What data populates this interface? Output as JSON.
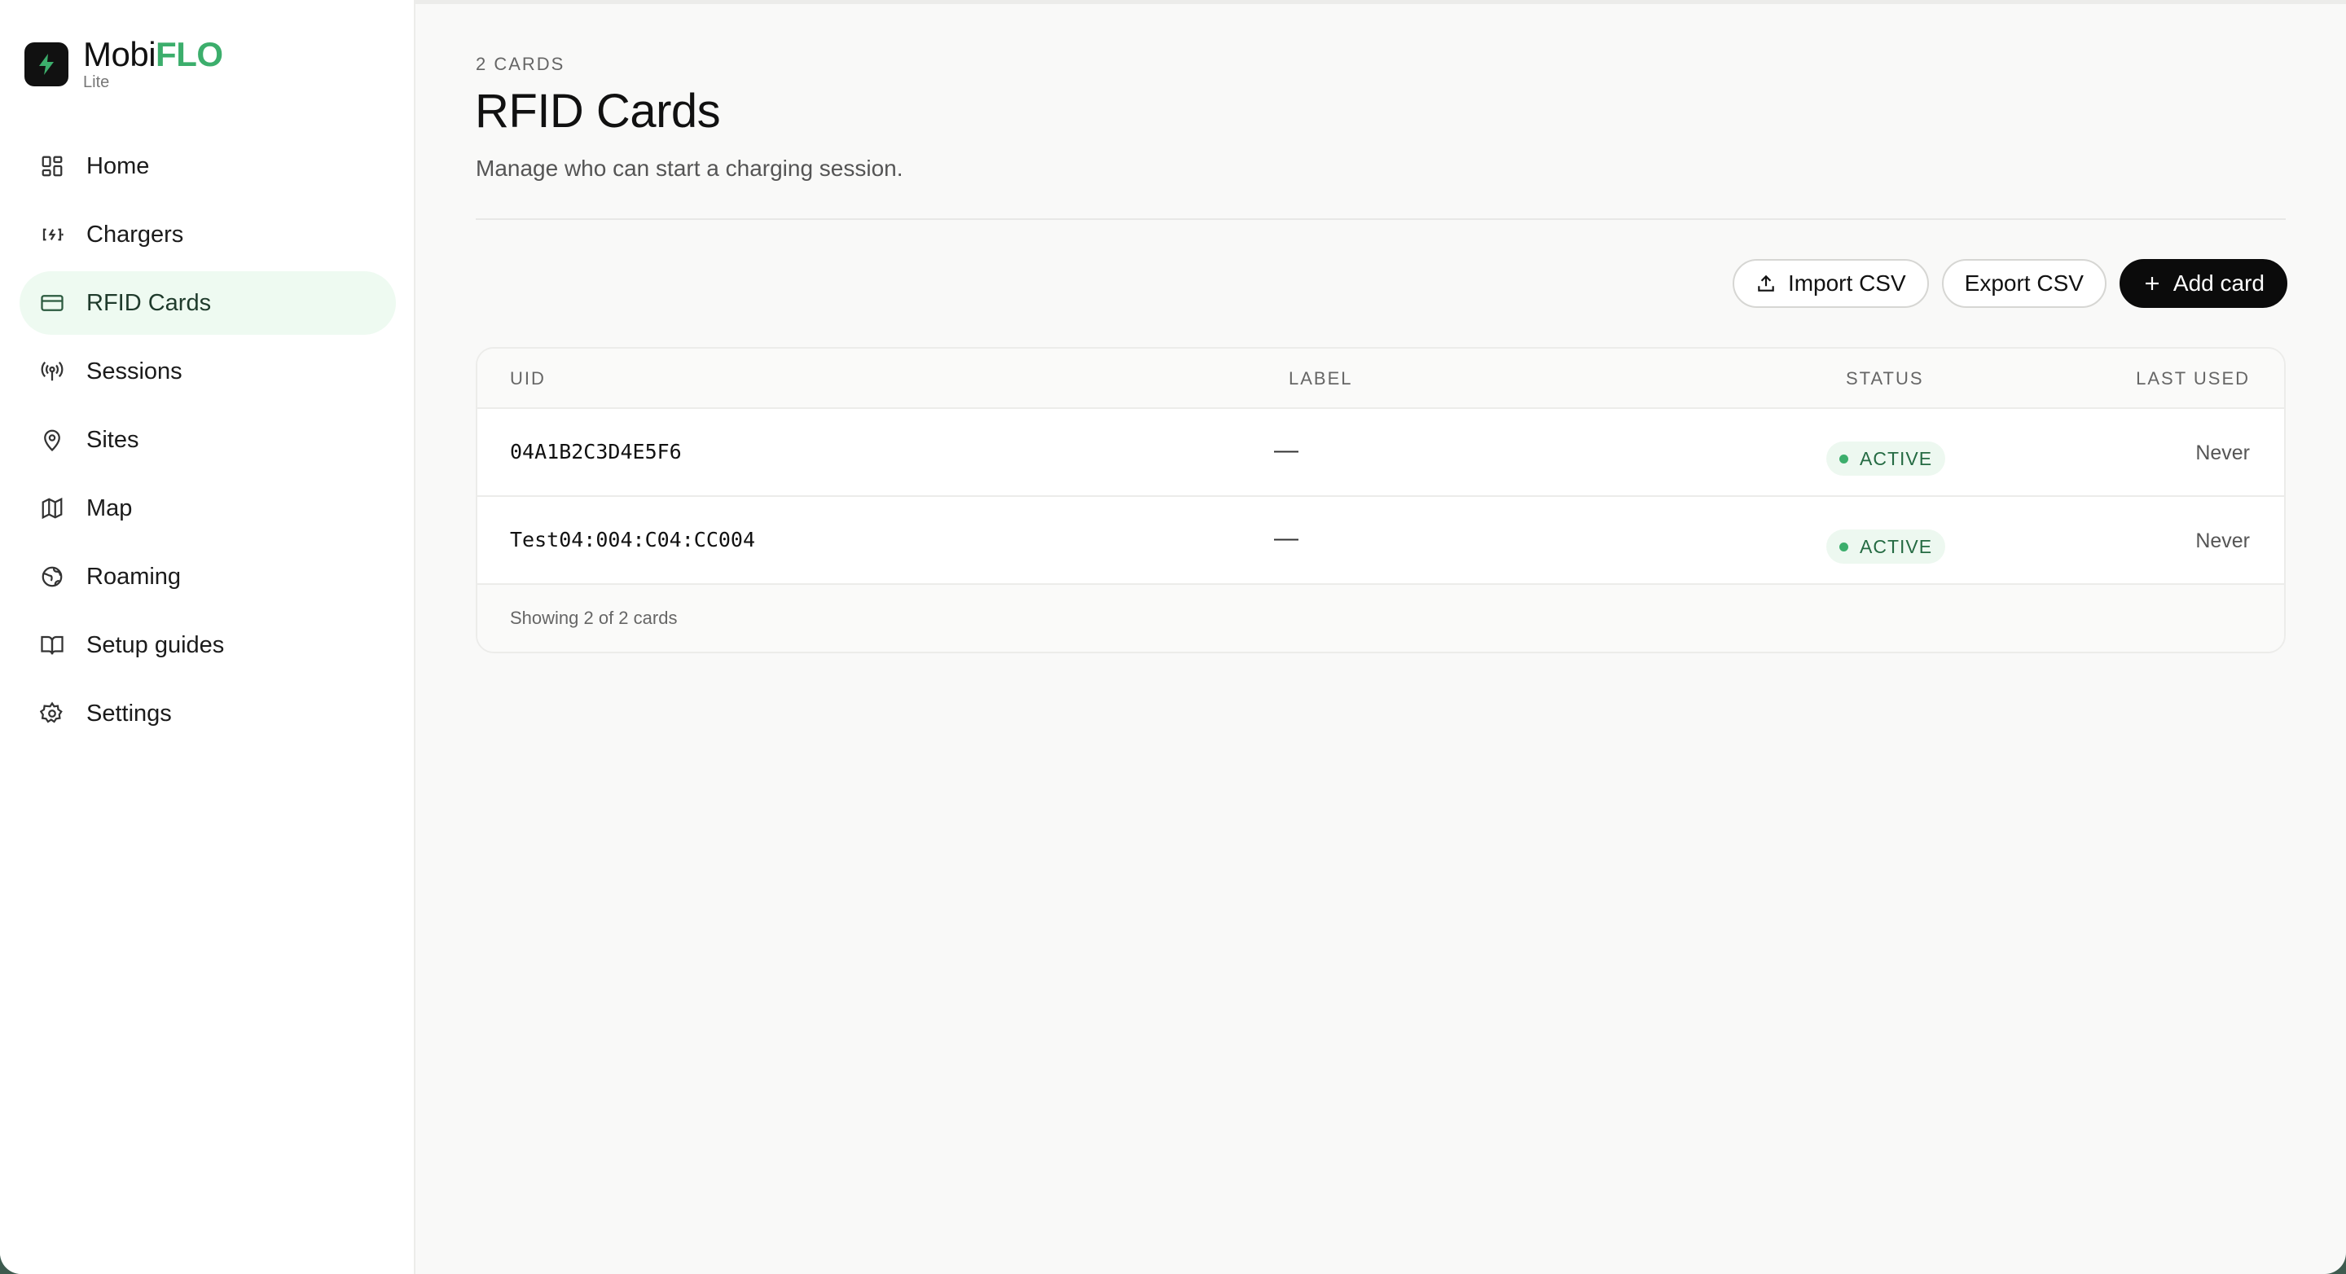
{
  "brand": {
    "name_prefix": "Mobi",
    "name_accent": "FLO",
    "tier": "Lite",
    "accent_color": "#3cae6c"
  },
  "sidebar": {
    "items": [
      {
        "label": "Home",
        "icon": "dashboard-grid-icon",
        "active": false
      },
      {
        "label": "Chargers",
        "icon": "charger-plug-icon",
        "active": false
      },
      {
        "label": "RFID Cards",
        "icon": "credit-card-icon",
        "active": true
      },
      {
        "label": "Sessions",
        "icon": "broadcast-antenna-icon",
        "active": false
      },
      {
        "label": "Sites",
        "icon": "location-pin-icon",
        "active": false
      },
      {
        "label": "Map",
        "icon": "folded-map-icon",
        "active": false
      },
      {
        "label": "Roaming",
        "icon": "globe-icon",
        "active": false
      },
      {
        "label": "Setup guides",
        "icon": "open-book-icon",
        "active": false
      },
      {
        "label": "Settings",
        "icon": "gear-icon",
        "active": false
      }
    ]
  },
  "page": {
    "eyebrow": "2 CARDS",
    "title": "RFID Cards",
    "subtitle": "Manage who can start a charging session."
  },
  "toolbar": {
    "import_label": "Import CSV",
    "export_label": "Export CSV",
    "add_label": "Add card"
  },
  "table": {
    "columns": {
      "uid": "UID",
      "label": "LABEL",
      "status": "STATUS",
      "last_used": "LAST USED"
    },
    "rows": [
      {
        "uid": "04A1B2C3D4E5F6",
        "label": "—",
        "status": "ACTIVE",
        "last_used": "Never"
      },
      {
        "uid": "Test04:004:C04:CC004",
        "label": "—",
        "status": "ACTIVE",
        "last_used": "Never"
      }
    ],
    "footer": "Showing 2 of 2 cards"
  }
}
